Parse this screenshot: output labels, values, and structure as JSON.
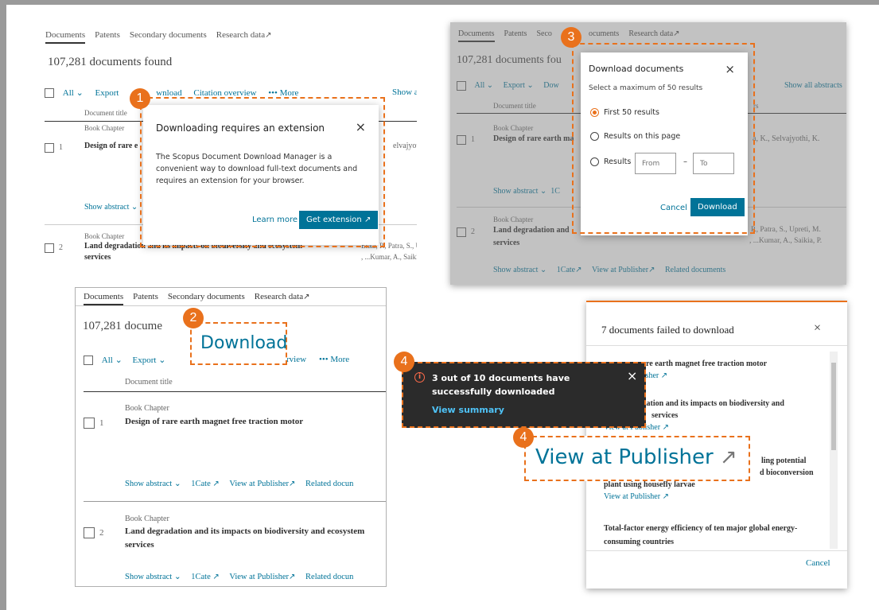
{
  "tabs": {
    "documents": "Documents",
    "patents": "Patents",
    "secondary": "Secondary documents",
    "secondary_short": "Seco",
    "research": "Research data"
  },
  "ext_icon": "↗",
  "count_text": "107,281 documents found",
  "count_trunc1": "107,281 documents fou",
  "count_trunc2": "107,281 docume",
  "toolbar": {
    "all": "All",
    "export": "Export",
    "download": "Download",
    "download_part": "wnload",
    "download_short": "Dow",
    "citation": "Citation overview",
    "citation_part": "rview",
    "more": "More",
    "show_all": "Show all abstracts",
    "show_trunc": "Show a"
  },
  "doc_title_header": "Document title",
  "doc_type": "Book Chapter",
  "rows": [
    {
      "num": "1",
      "title": "Design of rare earth magnet free traction motor",
      "title_trunc": "Design of rare e",
      "title_trunc3": "Design of rare earth ma",
      "authors_trunc1": "elvajyothi",
      "authors3": "a, K., Selvajyothi, K."
    },
    {
      "num": "2",
      "title_line1": "Land degradation and its impacts on biodiversity and ecosystem",
      "title_line2": "services",
      "title_obsc": "Land degradation and its impacts on biodiversity and ecosystem",
      "title_trunc3": "Land degradation and",
      "authors1": "Ekka, P., Patra, S., Up",
      "authors2": ", ...Kumar, A., Saikia,",
      "authors3a": "P., Patra, S., Upreti, M.",
      "authors3b": ", ...Kumar, A., Saikia, P."
    }
  ],
  "actions": {
    "show_abstract": "Show abstract",
    "show_abstract_trunc": "Show abstract",
    "icate": "1Cate",
    "ic_trunc": "1C",
    "view_publisher": "View at Publisher",
    "related": "Related documents",
    "related_trunc": "Related docun"
  },
  "modal1": {
    "title": "Downloading requires an extension",
    "body": "The Scopus Document Download Manager is a convenient way to download full-text documents and requires an extension for your browser.",
    "learn_more": "Learn more",
    "get_ext": "Get extension"
  },
  "modal3": {
    "title": "Download documents",
    "subtitle": "Select a maximum of 50 results",
    "opt1": "First 50 results",
    "opt2": "Results on this page",
    "opt3": "Results",
    "from": "From",
    "dash": "–",
    "to": "To",
    "cancel": "Cancel",
    "download": "Download",
    "authors_hdr": "rs"
  },
  "zoom2_label": "Download",
  "toast": {
    "message_line1": "3 out of 10 documents have",
    "message_line2": "successfully downloaded",
    "link": "View summary"
  },
  "zoom4_label": "View at Publisher",
  "failed": {
    "title": "7 documents failed to download",
    "item1": "are earth magnet free traction motor",
    "item1_link": "blisher",
    "item2a": "dation and its impacts on biodiversity and",
    "item2b": "services",
    "item2_link": "View at Publisher",
    "item3a": "ling potential",
    "item3b": "d bioconversion",
    "item3c": "plant using housefly larvae",
    "item3_link": "View at Publisher",
    "item4": "Total-factor energy efficiency of ten major global energy-consuming countries",
    "cancel": "Cancel"
  },
  "badges": {
    "b1": "1",
    "b2": "2",
    "b3": "3",
    "b4a": "4",
    "b4b": "4"
  },
  "close": "×",
  "colors": {
    "accent": "#e9711c",
    "link": "#007398",
    "toast_bg": "#2b2b2b"
  }
}
